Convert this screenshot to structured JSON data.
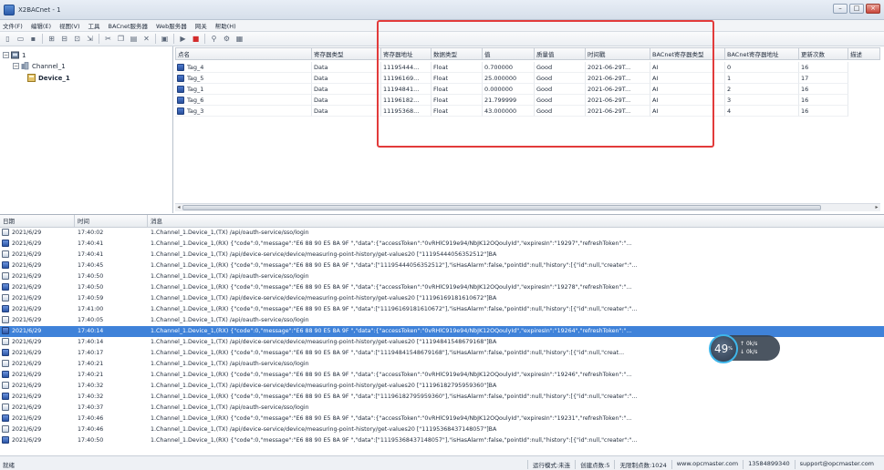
{
  "window": {
    "title": "X2BACnet - 1"
  },
  "menu": [
    "文件(F)",
    "编辑(E)",
    "视图(V)",
    "工具",
    "BACnet服务器",
    "Web服务器",
    "网关",
    "帮助(H)"
  ],
  "tree": {
    "root": "1",
    "channel": "Channel_1",
    "device": "Device_1"
  },
  "tag_grid": {
    "columns": [
      "点名",
      "寄存器类型",
      "寄存器地址",
      "数据类型",
      "值",
      "质量值",
      "时间戳",
      "BACnet寄存器类型",
      "BACnet寄存器地址",
      "更新次数",
      "描述"
    ],
    "rows": [
      {
        "name": "Tag_4",
        "reg_type": "Data",
        "reg_addr": "11195444...",
        "data_type": "Float",
        "value": "0.700000",
        "quality": "Good",
        "timestamp": "2021-06-29T...",
        "bac_type": "AI",
        "bac_addr": "0",
        "updates": "16"
      },
      {
        "name": "Tag_5",
        "reg_type": "Data",
        "reg_addr": "11196169...",
        "data_type": "Float",
        "value": "25.000000",
        "quality": "Good",
        "timestamp": "2021-06-29T...",
        "bac_type": "AI",
        "bac_addr": "1",
        "updates": "17"
      },
      {
        "name": "Tag_1",
        "reg_type": "Data",
        "reg_addr": "11194841...",
        "data_type": "Float",
        "value": "0.000000",
        "quality": "Good",
        "timestamp": "2021-06-29T...",
        "bac_type": "AI",
        "bac_addr": "2",
        "updates": "16"
      },
      {
        "name": "Tag_6",
        "reg_type": "Data",
        "reg_addr": "11196182...",
        "data_type": "Float",
        "value": "21.799999",
        "quality": "Good",
        "timestamp": "2021-06-29T...",
        "bac_type": "AI",
        "bac_addr": "3",
        "updates": "16"
      },
      {
        "name": "Tag_3",
        "reg_type": "Data",
        "reg_addr": "11195368...",
        "data_type": "Float",
        "value": "43.000000",
        "quality": "Good",
        "timestamp": "2021-06-29T...",
        "bac_type": "AI",
        "bac_addr": "4",
        "updates": "16"
      }
    ]
  },
  "log": {
    "columns": [
      "日期",
      "时间",
      "消息"
    ],
    "rows": [
      {
        "kind": "tx",
        "date": "2021/6/29",
        "time": "17:40:02",
        "msg": "1.Channel_1.Device_1,(TX) /api/oauth-service/sso/login"
      },
      {
        "kind": "rx",
        "date": "2021/6/29",
        "time": "17:40:41",
        "msg": "1.Channel_1.Device_1,(RX) {\"code\":0,\"message\":\"E6 88 90 E5 8A 9F \",\"data\":{\"accessToken\":\"0vRHlC919e94/NbJK12OQoulyId\",\"expiresIn\":\"19297\",\"refreshToken\":\"..."
      },
      {
        "kind": "tx",
        "date": "2021/6/29",
        "time": "17:40:41",
        "msg": "1.Channel_1.Device_1,(TX) /api/device-service/device/measuring-point-history/get-values20 [\"11195444056352512\"]BA"
      },
      {
        "kind": "rx",
        "date": "2021/6/29",
        "time": "17:40:45",
        "msg": "1.Channel_1.Device_1,(RX) {\"code\":0,\"message\":\"E6 88 90 E5 8A 9F \",\"data\":[\"11195444056352512\"],\"isHasAlarm\":false,\"pointId\":null,\"history\":[{\"id\":null,\"creater\":\"..."
      },
      {
        "kind": "tx",
        "date": "2021/6/29",
        "time": "17:40:50",
        "msg": "1.Channel_1.Device_1,(TX) /api/oauth-service/sso/login"
      },
      {
        "kind": "rx",
        "date": "2021/6/29",
        "time": "17:40:50",
        "msg": "1.Channel_1.Device_1,(RX) {\"code\":0,\"message\":\"E6 88 90 E5 8A 9F \",\"data\":{\"accessToken\":\"0vRHlC919e94/NbJK12OQoulyId\",\"expiresIn\":\"19278\",\"refreshToken\":\"..."
      },
      {
        "kind": "tx",
        "date": "2021/6/29",
        "time": "17:40:59",
        "msg": "1.Channel_1.Device_1,(TX) /api/device-service/device/measuring-point-history/get-values20 [\"11196169181610672\"]BA"
      },
      {
        "kind": "rx",
        "date": "2021/6/29",
        "time": "17:41:00",
        "msg": "1.Channel_1.Device_1,(RX) {\"code\":0,\"message\":\"E6 88 90 E5 8A 9F \",\"data\":[\"11196169181610672\"],\"isHasAlarm\":false,\"pointId\":null,\"history\":[{\"id\":null,\"creater\":\"..."
      },
      {
        "kind": "tx",
        "date": "2021/6/29",
        "time": "17:40:05",
        "msg": "1.Channel_1.Device_1,(TX) /api/oauth-service/sso/login"
      },
      {
        "kind": "rx",
        "date": "2021/6/29",
        "time": "17:40:14",
        "msg": "1.Channel_1.Device_1,(RX) {\"code\":0,\"message\":\"E6 88 90 E5 8A 9F \",\"data\":{\"accessToken\":\"0vRHlC919e94/NbJK12OQoulyId\",\"expiresIn\":\"19264\",\"refreshToken\":\"...",
        "selected": true
      },
      {
        "kind": "tx",
        "date": "2021/6/29",
        "time": "17:40:14",
        "msg": "1.Channel_1.Device_1,(TX) /api/device-service/device/measuring-point-history/get-values20 [\"11194841548679168\"]BA"
      },
      {
        "kind": "rx",
        "date": "2021/6/29",
        "time": "17:40:17",
        "msg": "1.Channel_1.Device_1,(RX) {\"code\":0,\"message\":\"E6 88 90 E5 8A 9F \",\"data\":[\"11194841548679168\"],\"isHasAlarm\":false,\"pointId\":null,\"history\":[{\"id\":null,\"creat..."
      },
      {
        "kind": "tx",
        "date": "2021/6/29",
        "time": "17:40:21",
        "msg": "1.Channel_1.Device_1,(TX) /api/oauth-service/sso/login"
      },
      {
        "kind": "rx",
        "date": "2021/6/29",
        "time": "17:40:21",
        "msg": "1.Channel_1.Device_1,(RX) {\"code\":0,\"message\":\"E6 88 90 E5 8A 9F \",\"data\":{\"accessToken\":\"0vRHlC919e94/NbJK12OQoulyId\",\"expiresIn\":\"19246\",\"refreshToken\":\"..."
      },
      {
        "kind": "tx",
        "date": "2021/6/29",
        "time": "17:40:32",
        "msg": "1.Channel_1.Device_1,(TX) /api/device-service/device/measuring-point-history/get-values20 [\"11196182795959360\"]BA"
      },
      {
        "kind": "rx",
        "date": "2021/6/29",
        "time": "17:40:32",
        "msg": "1.Channel_1.Device_1,(RX) {\"code\":0,\"message\":\"E6 88 90 E5 8A 9F \",\"data\":[\"11196182795959360\"],\"isHasAlarm\":false,\"pointId\":null,\"history\":[{\"id\":null,\"creater\":\"..."
      },
      {
        "kind": "tx",
        "date": "2021/6/29",
        "time": "17:40:37",
        "msg": "1.Channel_1.Device_1,(TX) /api/oauth-service/sso/login"
      },
      {
        "kind": "rx",
        "date": "2021/6/29",
        "time": "17:40:46",
        "msg": "1.Channel_1.Device_1,(RX) {\"code\":0,\"message\":\"E6 88 90 E5 8A 9F \",\"data\":{\"accessToken\":\"0vRHlC919e94/NbJK12OQoulyId\",\"expiresIn\":\"19231\",\"refreshToken\":\"..."
      },
      {
        "kind": "tx",
        "date": "2021/6/29",
        "time": "17:40:46",
        "msg": "1.Channel_1.Device_1,(TX) /api/device-service/device/measuring-point-history/get-values20 [\"11195368437148057\"]BA"
      },
      {
        "kind": "rx",
        "date": "2021/6/29",
        "time": "17:40:50",
        "msg": "1.Channel_1.Device_1,(RX) {\"code\":0,\"message\":\"E6 88 90 E5 8A 9F \",\"data\":[\"11195368437148057\"],\"isHasAlarm\":false,\"pointId\":null,\"history\":[{\"id\":null,\"creater\":\"..."
      }
    ]
  },
  "overlay": {
    "value": "49",
    "unit": "%",
    "up": "0k/s",
    "down": "0k/s"
  },
  "status": {
    "left": "就绪",
    "segments": [
      "运行模式:未连",
      "创建点数:5",
      "无限制点数:1024",
      "www.opcmaster.com",
      "13584899340",
      "support@opcmaster.com"
    ]
  },
  "colors": {
    "highlight_box": "#e23b3b",
    "selection": "#3f82d9"
  }
}
